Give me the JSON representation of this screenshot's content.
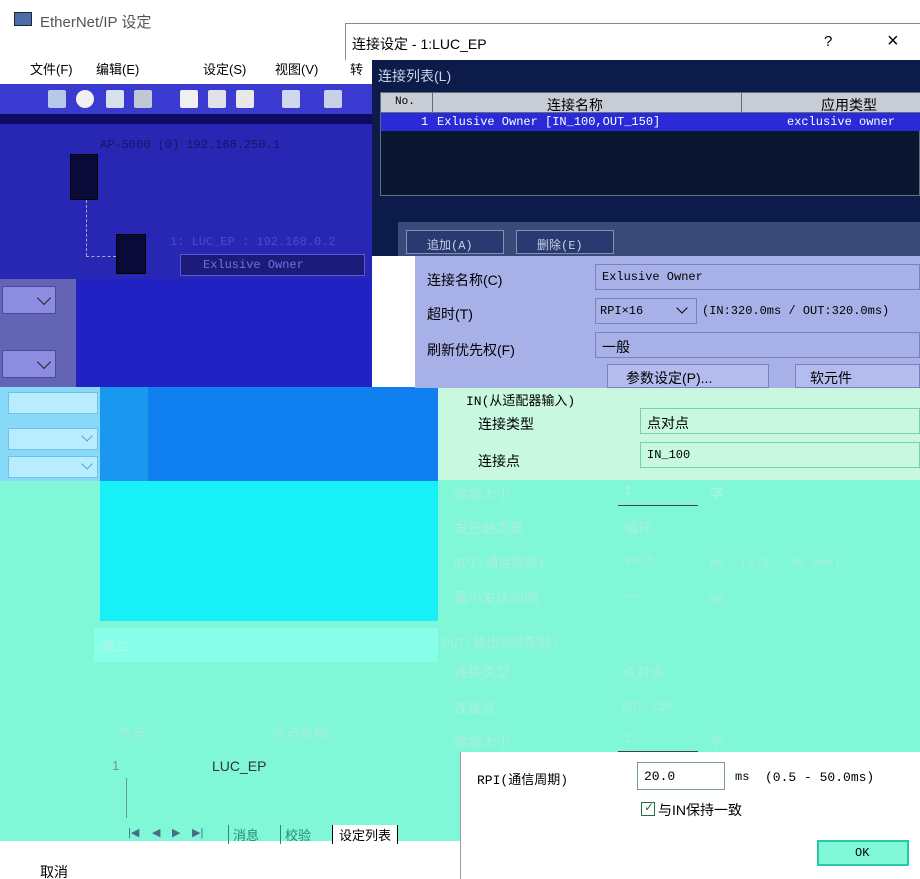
{
  "main_window": {
    "title": "EtherNet/IP 设定",
    "menu": [
      "文件(F)",
      "编辑(E)",
      "设定(S)",
      "视图(V)",
      "转"
    ],
    "network_label": "AP-5000 (0) 192.168.250.1",
    "node_label": "1: LUC_EP : 192.168.0.2",
    "conn_tag": "Exlusive Owner",
    "tabs": {
      "msg": "消息",
      "check": "校验",
      "setlist": "设定列表"
    },
    "table_cols": {
      "node": "节点",
      "node_name": "节点名称"
    },
    "row_node": "1",
    "row_name": "LUC_EP",
    "section_label": "第二",
    "cancel": "取消"
  },
  "dialog": {
    "title": "连接设定 - 1:LUC_EP",
    "help": "?",
    "close": "×",
    "list_label": "连接列表(L)",
    "columns": {
      "no": "No.",
      "name": "连接名称",
      "type": "应用类型"
    },
    "rows": [
      {
        "no": "1",
        "name": "Exlusive Owner [IN_100,OUT_150]",
        "type": "exclusive owner"
      }
    ],
    "add_button": "追加(A)",
    "delete_button": "删除(E)",
    "conn_name_label": "连接名称(C)",
    "conn_name_value": "Exlusive Owner",
    "timeout_label": "超时(T)",
    "timeout_value": "RPI×16",
    "timeout_info": "(IN:320.0ms / OUT:320.0ms)",
    "priority_label": "刷新优先权(F)",
    "priority_value": "一般",
    "param_button": "参数设定(P)...",
    "soft_button": "软元件",
    "in": {
      "header": "IN(从适配器输入)",
      "type_label": "连接类型",
      "type_value": "点对点",
      "point_label": "连接点",
      "point_value": "IN_100",
      "size_label": "数据大小",
      "size_value": "1",
      "size_unit": "字",
      "trigger_label": "发送触发器",
      "trigger_value": "循环",
      "rpi_label": "RPI(通信周期)",
      "rpi_value": "20.0",
      "rpi_unit": "ms",
      "rpi_range": "(0.5 - 50.0ms)",
      "min_label": "最小发送间隔",
      "min_value": "—",
      "min_unit": "ms"
    },
    "out": {
      "header": "OUT(输出到适配器)",
      "type_label": "连接类型",
      "type_value": "点对点",
      "point_label": "连接点",
      "point_value": "OUT_150",
      "size_label": "数据大小",
      "size_value": "1",
      "size_unit": "字",
      "rpi_label": "RPI(通信周期)",
      "rpi_value": "20.0",
      "rpi_unit": "ms",
      "rpi_range": "(0.5 - 50.0ms)",
      "same_as_in": "与IN保持一致"
    },
    "ok_button": "OK"
  }
}
